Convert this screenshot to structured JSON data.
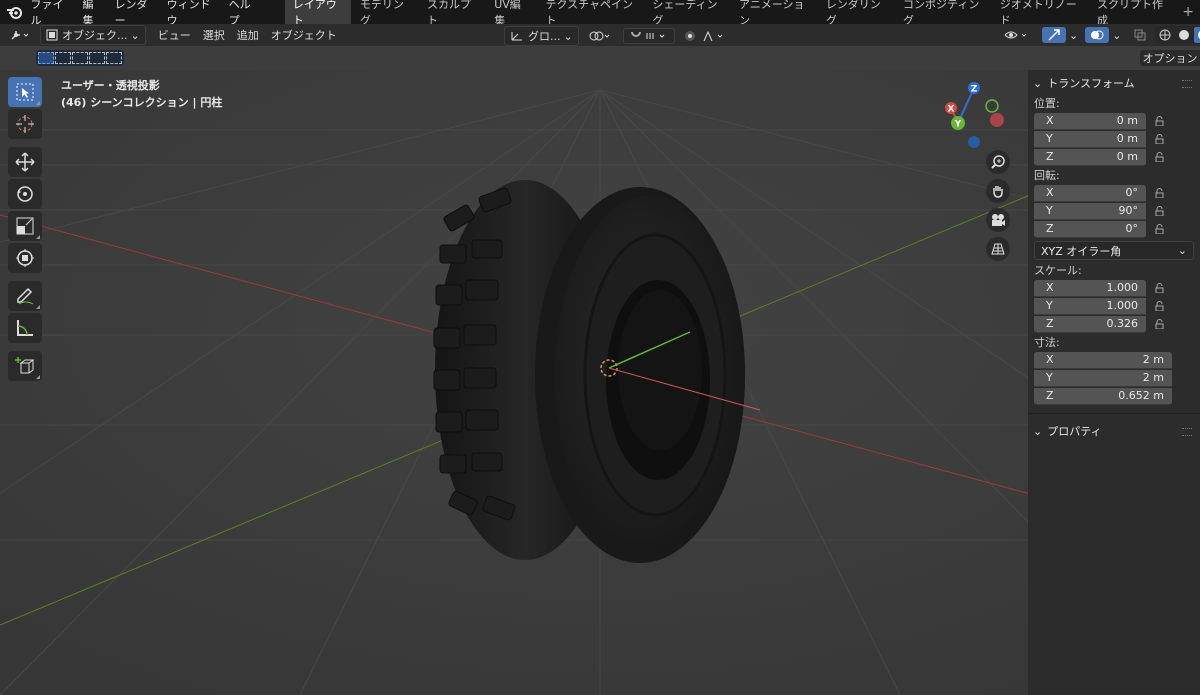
{
  "topbar": {
    "menu": [
      "ファイル",
      "編集",
      "レンダー",
      "ウィンドウ",
      "ヘルプ"
    ],
    "tabs": [
      "レイアウト",
      "モデリング",
      "スカルプト",
      "UV編集",
      "テクスチャペイント",
      "シェーディング",
      "アニメーション",
      "レンダリング",
      "コンポジティング",
      "ジオメトリノード",
      "スクリプト作成"
    ],
    "add_tab": "+"
  },
  "header": {
    "mode": "オブジェク...",
    "menu": [
      "ビュー",
      "選択",
      "追加",
      "オブジェクト"
    ],
    "transform_orientation": "グロ...",
    "options": "オプション"
  },
  "viewport": {
    "view_name": "ユーザー・透視投影",
    "collection": "(46) シーンコレクション | 円柱"
  },
  "gizmo": {
    "x": "X",
    "y": "Y",
    "z": "Z"
  },
  "npanel": {
    "transform_title": "トランスフォーム",
    "location_label": "位置:",
    "location": [
      {
        "axis": "X",
        "value": "0 m"
      },
      {
        "axis": "Y",
        "value": "0 m"
      },
      {
        "axis": "Z",
        "value": "0 m"
      }
    ],
    "rotation_label": "回転:",
    "rotation": [
      {
        "axis": "X",
        "value": "0°"
      },
      {
        "axis": "Y",
        "value": "90°"
      },
      {
        "axis": "Z",
        "value": "0°"
      }
    ],
    "rotation_mode": "XYZ オイラー角",
    "scale_label": "スケール:",
    "scale": [
      {
        "axis": "X",
        "value": "1.000"
      },
      {
        "axis": "Y",
        "value": "1.000"
      },
      {
        "axis": "Z",
        "value": "0.326"
      }
    ],
    "dimensions_label": "寸法:",
    "dimensions": [
      {
        "axis": "X",
        "value": "2 m"
      },
      {
        "axis": "Y",
        "value": "2 m"
      },
      {
        "axis": "Z",
        "value": "0.652 m"
      }
    ],
    "properties_title": "プロパティ"
  }
}
